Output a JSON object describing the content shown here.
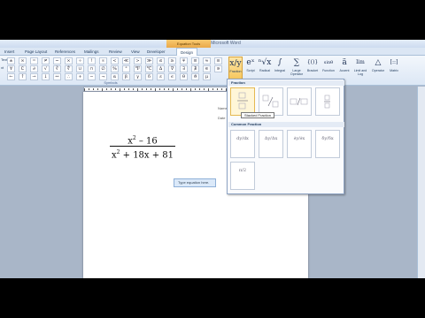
{
  "window": {
    "title": "Document1 - Microsoft Word",
    "contextual_tab": "Equation Tools"
  },
  "tabs": [
    "Insert",
    "Page Layout",
    "References",
    "Mailings",
    "Review",
    "View",
    "Developer",
    "Design"
  ],
  "ribbon": {
    "left_group": [
      "Text",
      "xt"
    ],
    "symbols_group_label": "Symbols",
    "symbols": [
      "±",
      "∞",
      "=",
      "≠",
      "~",
      "×",
      "÷",
      "!",
      "∝",
      "<",
      "≪",
      ">",
      "≫",
      "≤",
      "≥",
      "∓",
      "≅",
      "≈",
      "≡",
      "∀",
      "∁",
      "∂",
      "√",
      "∛",
      "∜",
      "∪",
      "∩",
      "∅",
      "%",
      "°",
      "℉",
      "℃",
      "∆",
      "∇",
      "∃",
      "∄",
      "∈",
      "∋",
      "←",
      "↑",
      "→",
      "↓",
      "↔",
      "∴",
      "+",
      "−",
      "¬",
      "α",
      "β",
      "γ",
      "δ",
      "ε",
      "ϵ",
      "θ",
      "ϑ",
      "μ"
    ],
    "structures": [
      {
        "label": "Fraction",
        "icon": "x/y"
      },
      {
        "label": "Script",
        "icon": "eˣ"
      },
      {
        "label": "Radical",
        "icon": "ⁿ√x"
      },
      {
        "label": "Integral",
        "icon": "∫"
      },
      {
        "label": "Large Operator",
        "icon": "∑"
      },
      {
        "label": "Bracket",
        "icon": "{()}"
      },
      {
        "label": "Function",
        "icon": "sinθ"
      },
      {
        "label": "Accent",
        "icon": "ä"
      },
      {
        "label": "Limit and Log",
        "icon": "lim"
      },
      {
        "label": "Operator",
        "icon": "△"
      },
      {
        "label": "Matrix",
        "icon": "[::]"
      }
    ]
  },
  "document": {
    "numerator": "x",
    "numerator_exp": "2",
    "numerator_rest": " – 16",
    "denominator": "x",
    "denominator_exp": "2",
    "denominator_rest": " + 18x + 81",
    "eq_placeholder": "Type equation here.",
    "side_text": [
      "Name",
      "Date"
    ]
  },
  "fraction_menu": {
    "header": "Fraction",
    "common_header": "Common Fraction",
    "tooltip": "Stacked Fraction",
    "common": [
      "dy/dx",
      "Δy/Δx",
      "∂y/∂x",
      "δy/δx"
    ],
    "last": "π/2"
  }
}
